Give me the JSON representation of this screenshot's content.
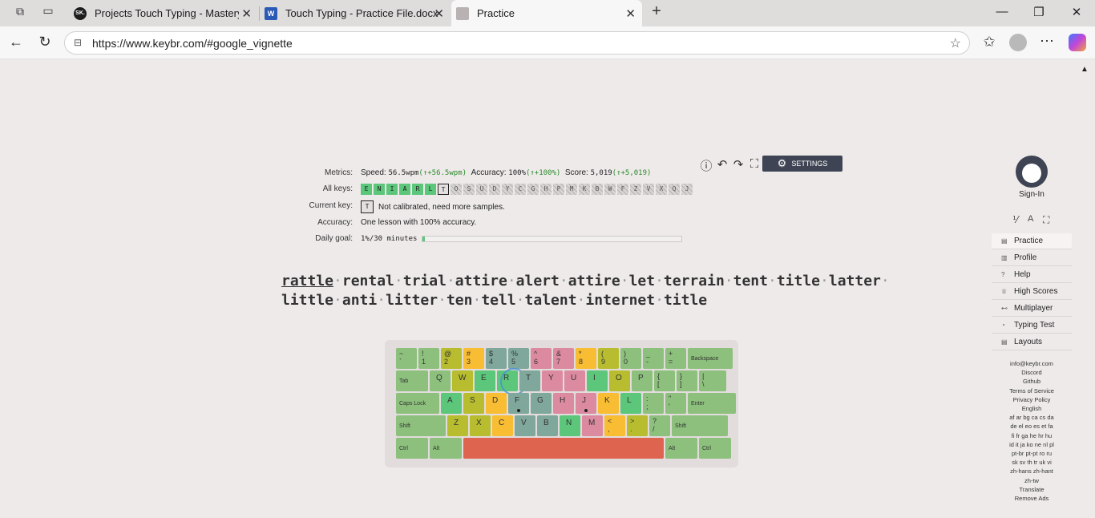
{
  "browser": {
    "tabs": [
      {
        "title": "Projects Touch Typing - Mastery C",
        "favicon_text": "SK."
      },
      {
        "title": "Touch Typing - Practice File.docx",
        "favicon_text": "W"
      },
      {
        "title": "Practice"
      }
    ],
    "url": "https://www.keybr.com/#google_vignette",
    "new_tab": "+",
    "close_glyph": "✕"
  },
  "toolbar": {
    "settings_label": "SETTINGS"
  },
  "metrics": {
    "metrics_label": "Metrics:",
    "speed_label": "Speed:",
    "speed_value": "56.5wpm",
    "speed_delta": "(↑+56.5wpm)",
    "accuracy_label": "Accuracy:",
    "accuracy_value": "100%",
    "accuracy_delta": "(↑+100%)",
    "score_label": "Score:",
    "score_value": "5,019",
    "score_delta": "(↑+5,019)",
    "allkeys_label": "All keys:",
    "current_key_label": "Current key:",
    "current_key": "T",
    "current_key_text": "Not calibrated, need more samples.",
    "accuracy_row_label": "Accuracy:",
    "accuracy_row_text": "One lesson with 100% accuracy.",
    "daily_goal_label": "Daily goal:",
    "daily_goal_value": "1%/30 minutes",
    "daily_goal_progress": 0.01
  },
  "all_keys": [
    {
      "k": "E",
      "s": "on"
    },
    {
      "k": "N",
      "s": "on"
    },
    {
      "k": "I",
      "s": "on"
    },
    {
      "k": "A",
      "s": "on"
    },
    {
      "k": "R",
      "s": "on"
    },
    {
      "k": "L",
      "s": "on"
    },
    {
      "k": "T",
      "s": "cur"
    },
    {
      "k": "O",
      "s": "off"
    },
    {
      "k": "S",
      "s": "off"
    },
    {
      "k": "U",
      "s": "off"
    },
    {
      "k": "D",
      "s": "off"
    },
    {
      "k": "Y",
      "s": "off"
    },
    {
      "k": "C",
      "s": "off"
    },
    {
      "k": "G",
      "s": "off"
    },
    {
      "k": "H",
      "s": "off"
    },
    {
      "k": "P",
      "s": "off"
    },
    {
      "k": "M",
      "s": "off"
    },
    {
      "k": "K",
      "s": "off"
    },
    {
      "k": "B",
      "s": "off"
    },
    {
      "k": "W",
      "s": "off"
    },
    {
      "k": "F",
      "s": "off"
    },
    {
      "k": "Z",
      "s": "off"
    },
    {
      "k": "V",
      "s": "off"
    },
    {
      "k": "X",
      "s": "off"
    },
    {
      "k": "Q",
      "s": "off"
    },
    {
      "k": "J",
      "s": "off"
    }
  ],
  "lesson": {
    "line1": [
      "rattle",
      "rental",
      "trial",
      "attire",
      "alert",
      "attire",
      "let",
      "terrain",
      "tent",
      "title",
      "latter"
    ],
    "line2": [
      "little",
      "anti",
      "litter",
      "ten",
      "tell",
      "talent",
      "internet",
      "title"
    ]
  },
  "keyboard": {
    "row1": [
      [
        "~",
        "`"
      ],
      [
        "!",
        "1"
      ],
      [
        "@",
        "2"
      ],
      [
        "#",
        "3"
      ],
      [
        "$",
        "4"
      ],
      [
        "%",
        "5"
      ],
      [
        "^",
        "6"
      ],
      [
        "&",
        "7"
      ],
      [
        "*",
        "8"
      ],
      [
        "(",
        "9"
      ],
      [
        ")",
        "0"
      ],
      [
        "_",
        "-"
      ],
      [
        "+",
        "="
      ],
      [
        "Backspace",
        ""
      ]
    ],
    "row2": [
      "Tab",
      "Q",
      "W",
      "E",
      "R",
      "T",
      "Y",
      "U",
      "I",
      "O",
      "P",
      [
        "{",
        "["
      ],
      [
        "}",
        "]"
      ],
      [
        "|",
        "\\"
      ]
    ],
    "row3": [
      "Caps Lock",
      "A",
      "S",
      "D",
      "F",
      "G",
      "H",
      "J",
      "K",
      "L",
      [
        ":",
        ";"
      ],
      [
        "\"",
        "'"
      ],
      "Enter"
    ],
    "row4": [
      "Shift",
      "Z",
      "X",
      "C",
      "V",
      "B",
      "N",
      "M",
      [
        "<",
        ","
      ],
      [
        ">",
        "."
      ],
      [
        "?",
        "/"
      ],
      "Shift"
    ],
    "row5": [
      "Ctrl",
      "Alt",
      "",
      "Alt",
      "Ctrl"
    ]
  },
  "colors": {
    "green": "#8cc07c",
    "olive": "#b7bd2e",
    "yellow": "#f8bd33",
    "teal": "#7fa79c",
    "pink": "#dc8aa0",
    "red": "#de6450",
    "active": "#5cc67a"
  },
  "sidebar": {
    "sign_in": "Sign-In",
    "nav": [
      {
        "label": "Practice",
        "icon": "keyboard-icon"
      },
      {
        "label": "Profile",
        "icon": "chart-icon"
      },
      {
        "label": "Help",
        "icon": "help-icon"
      },
      {
        "label": "High Scores",
        "icon": "trophy-icon"
      },
      {
        "label": "Multiplayer",
        "icon": "car-icon"
      },
      {
        "label": "Typing Test",
        "icon": "gauge-icon"
      },
      {
        "label": "Layouts",
        "icon": "keyboard-icon"
      }
    ],
    "footer": [
      "info@keybr.com",
      "Discord",
      "Github",
      "Terms of Service",
      "Privacy Policy",
      "English",
      "af ar bg ca cs da",
      "de el eo es et fa",
      "fi fr ga he hr hu",
      "id it ja ko ne nl pl",
      "pt-br pt-pt ro ru",
      "sk sv th tr uk vi",
      "zh-hans zh-hant",
      "zh-tw",
      "Translate",
      "Remove Ads"
    ]
  }
}
